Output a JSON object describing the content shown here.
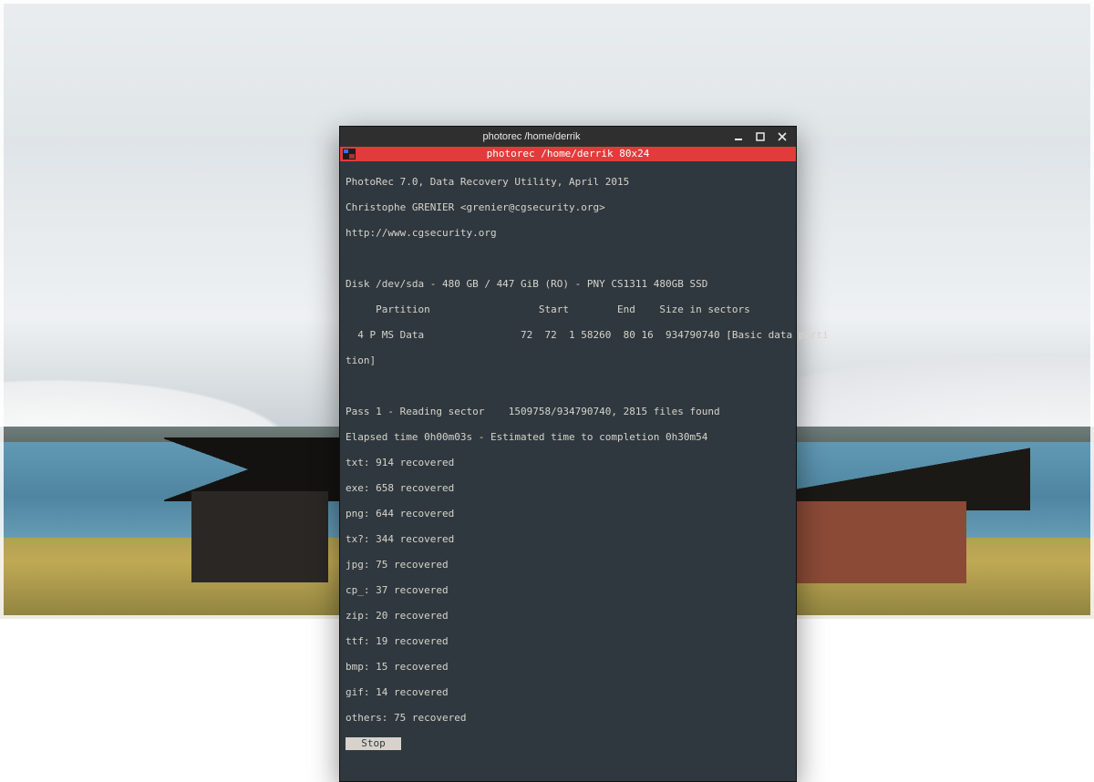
{
  "window": {
    "outer_title": "photorec  /home/derrik",
    "inner_title": "photorec  /home/derrik 80x24"
  },
  "terminal": {
    "app_header": {
      "name_version": "PhotoRec 7.0, Data Recovery Utility, April 2015",
      "author": "Christophe GRENIER <grenier@cgsecurity.org>",
      "url": "http://www.cgsecurity.org"
    },
    "disk_line": "Disk /dev/sda - 480 GB / 447 GiB (RO) - PNY CS1311 480GB SSD",
    "table_header": "     Partition                  Start        End    Size in sectors",
    "partition_row": "  4 P MS Data                72  72  1 58260  80 16  934790740 [Basic data parti",
    "partition_row_wrap": "tion]",
    "progress": {
      "pass_line": "Pass 1 - Reading sector    1509758/934790740, 2815 files found",
      "elapsed_line": "Elapsed time 0h00m03s - Estimated time to completion 0h30m54"
    },
    "recovered": [
      "txt: 914 recovered",
      "exe: 658 recovered",
      "png: 644 recovered",
      "tx?: 344 recovered",
      "jpg: 75 recovered",
      "cp_: 37 recovered",
      "zip: 20 recovered",
      "ttf: 19 recovered",
      "bmp: 15 recovered",
      "gif: 14 recovered",
      "others: 75 recovered"
    ],
    "stop_label": "  Stop  "
  }
}
